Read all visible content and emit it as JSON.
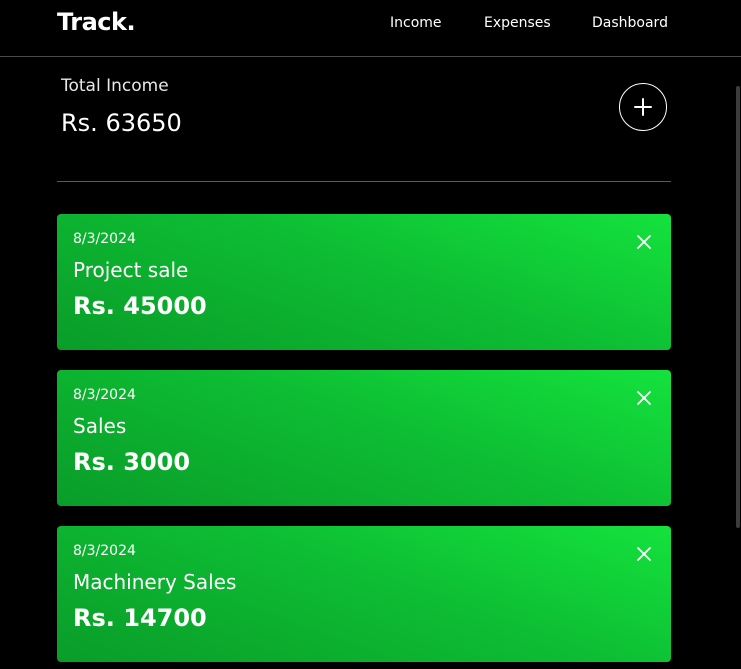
{
  "header": {
    "logo": "Track.",
    "nav": [
      "Income",
      "Expenses",
      "Dashboard"
    ]
  },
  "summary": {
    "label": "Total Income",
    "value": "Rs. 63650"
  },
  "entries": [
    {
      "date": "8/3/2024",
      "title": "Project sale",
      "amount": "Rs. 45000"
    },
    {
      "date": "8/3/2024",
      "title": "Sales",
      "amount": "Rs. 3000"
    },
    {
      "date": "8/3/2024",
      "title": "Machinery Sales",
      "amount": "Rs. 14700"
    }
  ],
  "colors": {
    "background": "#000000",
    "card_dark": "#0a9c29",
    "card_light": "#14e23d",
    "text": "#ffffff"
  },
  "icons": {
    "add": "plus-icon",
    "remove": "close-icon"
  }
}
